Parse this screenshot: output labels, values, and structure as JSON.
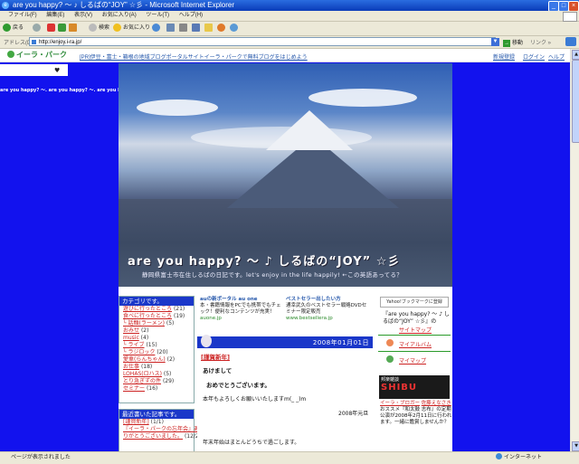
{
  "window": {
    "title": "are you happy? ～ ♪ しるばの“JOY” ☆彡 - Microsoft Internet Explorer",
    "controls": [
      "_",
      "□",
      "×"
    ]
  },
  "menubar": [
    "ファイル(F)",
    "編集(E)",
    "表示(V)",
    "お気に入り(A)",
    "ツール(T)",
    "ヘルプ(H)"
  ],
  "toolbar": {
    "back": "戻る",
    "search": "検索",
    "favorites": "お気に入り"
  },
  "address": {
    "label": "アドレス(D)",
    "url": "http://enjoy.i-ra.jp/",
    "go": "移動",
    "links": "リンク »"
  },
  "site_header": {
    "logo": "イーラ・パーク",
    "pr_link": "[PR]伊豆・富士・箱根の地域ブログポータルサイトイーラ・パークで無料ブログをはじめよう",
    "register": "新規登録",
    "login": "ログイン",
    "help": "ヘルプ"
  },
  "marquee": "are you happy? ～. are you happy? ～. are you happy? ～. are you happy? ～. are you happy? ～. are you happy? ～. are you happy? ～. are you happy? ～.",
  "blog": {
    "title": "are you happy? ～ ♪ しるばの“JOY” ☆彡",
    "subtitle": "静岡県富士市在住しるばの日記です。let's enjoy in the life happily! ←この英語あってる？"
  },
  "categories": {
    "header": "カテゴリです。",
    "items": [
      {
        "label": "遊びに行ったところ",
        "count": "(21)"
      },
      {
        "label": "食べに行ったところ",
        "count": "(19)"
      },
      {
        "label": "└ 話麺(ラーメン)",
        "count": "(5)"
      },
      {
        "label": "おみせ",
        "count": "(2)"
      },
      {
        "label": "music",
        "count": "(4)"
      },
      {
        "label": "└ ライブ",
        "count": "(15)"
      },
      {
        "label": "└ ラジロック",
        "count": "(20)"
      },
      {
        "label": "愛車(らんちゃん)",
        "count": "(2)"
      },
      {
        "label": "お仕事",
        "count": "(18)"
      },
      {
        "label": "LOHAS(ロハス)",
        "count": "(5)"
      },
      {
        "label": "とり急ぎずの件",
        "count": "(29)"
      },
      {
        "label": "セミナー",
        "count": "(16)"
      }
    ]
  },
  "recent": {
    "header": "最近書いた記事です。",
    "items": [
      {
        "label": "[謹賀新年]",
        "count": "(1/1)"
      },
      {
        "label": "『イーラ・パークの忘年会』あ",
        "count": ""
      },
      {
        "label": "りがとうございました。",
        "count": "(12/29)"
      }
    ]
  },
  "ads": {
    "ad1": {
      "title": "auの新ポータル au one",
      "body": "本・書籍情報をPCでも携帯でもチェック！便利なコンテンツが充実！",
      "url": "auone.jp"
    },
    "ad2": {
      "title": "ベストセラー出したい方",
      "body": "通幸武久のベストセラー戦略DVDセミナー限定販売",
      "url": "www.bestsellera.jp"
    }
  },
  "entry": {
    "date": "2008年01月01日",
    "category": "[謹賀新年]",
    "lines": [
      "あけまして",
      "おめでとうございます。",
      "本年もよろしくお願いいたしますm(_ _)m",
      "2008年元旦",
      "年末年始はまとんどうちで過ごします。"
    ]
  },
  "right": {
    "yahoo": "Yahoo!ブックマークに登録",
    "blog_title": "『are you happy? ～ ♪ しるばの“JOY” ☆彡』の",
    "links": [
      "サイトマップ",
      "マイアルバム",
      "マイマップ"
    ],
    "shibu_label": "邦楽雑談",
    "shibu_logo": "SHIBU",
    "shibu_text_a": "イーラ・ブロガー",
    "shibu_text_b": "佐藤えなさき",
    "shibu_text": "おススメ『和太鼓 志布』の定期公演が2008年2月11日に行われます。一緒に鑑賞しませんか？"
  },
  "status": {
    "text": "ページが表示されました",
    "zone": "インターネット"
  }
}
